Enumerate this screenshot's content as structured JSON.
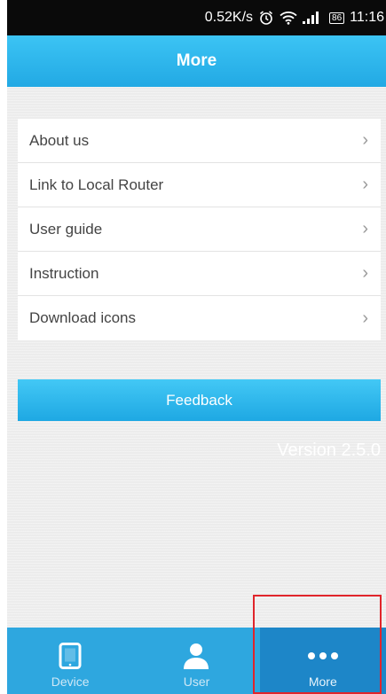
{
  "status": {
    "speed": "0.52K/s",
    "battery": "86",
    "time": "11:16"
  },
  "header": {
    "title": "More"
  },
  "menu": {
    "items": [
      {
        "label": "About us"
      },
      {
        "label": "Link to Local Router"
      },
      {
        "label": "User guide"
      },
      {
        "label": "Instruction"
      },
      {
        "label": "Download icons"
      }
    ]
  },
  "feedback": {
    "label": "Feedback"
  },
  "version": "Version 2.5.0",
  "tabs": [
    {
      "label": "Device",
      "icon": "tablet-icon"
    },
    {
      "label": "User",
      "icon": "user-icon"
    },
    {
      "label": "More",
      "icon": "more-dots-icon",
      "active": true
    }
  ],
  "colors": {
    "accent": "#2ea7df",
    "header": "#3cc4f4",
    "selection_box": "#e0252b"
  }
}
